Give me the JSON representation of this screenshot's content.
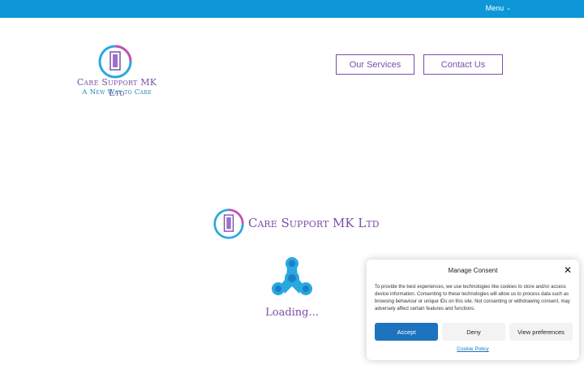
{
  "topbar": {
    "menu_label": "Menu",
    "menu_icon": "chevron-down-icon",
    "color": "#0d97d9"
  },
  "brand": {
    "name": "Care Support MK Ltd",
    "tagline": "A New Way to Care",
    "primary_color": "#7b4fa8",
    "secondary_color": "#1c86b8"
  },
  "nav": [
    {
      "label": "Our Services"
    },
    {
      "label": "Contact Us"
    }
  ],
  "loader": {
    "brand_name": "Care Support MK Ltd",
    "text": "Loading...",
    "icon": "fidget-spinner-icon",
    "icon_color": "#29a8e0"
  },
  "consent": {
    "title": "Manage Consent",
    "body": "To provide the best experiences, we use technologies like cookies to store and/or access device information. Consenting to these technologies will allow us to process data such as browsing behaviour or unique IDs on this site. Not consenting or withdrawing consent, may adversely affect certain features and functions.",
    "accept_label": "Accept",
    "deny_label": "Deny",
    "preferences_label": "View preferences",
    "policy_link": "Cookie Policy",
    "accept_color": "#1e73be"
  }
}
